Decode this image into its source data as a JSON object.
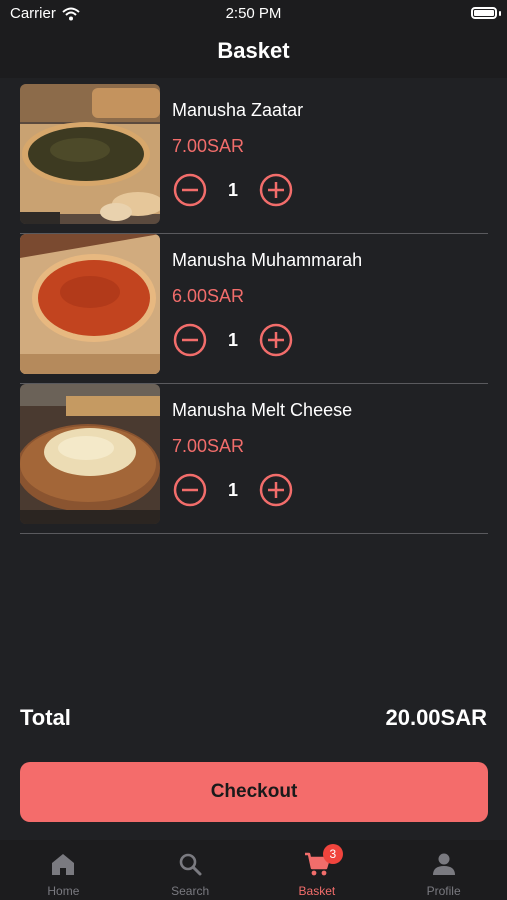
{
  "status_bar": {
    "carrier": "Carrier",
    "time": "2:50 PM"
  },
  "header": {
    "title": "Basket"
  },
  "items": [
    {
      "name": "Manusha Zaatar",
      "price": "7.00SAR",
      "quantity": "1"
    },
    {
      "name": "Manusha Muhammarah",
      "price": "6.00SAR",
      "quantity": "1"
    },
    {
      "name": "Manusha Melt Cheese",
      "price": "7.00SAR",
      "quantity": "1"
    }
  ],
  "summary": {
    "total_label": "Total",
    "total_value": "20.00SAR"
  },
  "checkout": {
    "label": "Checkout"
  },
  "tabbar": {
    "tabs": [
      {
        "label": "Home",
        "icon": "home-icon"
      },
      {
        "label": "Search",
        "icon": "search-icon"
      },
      {
        "label": "Basket",
        "icon": "cart-icon",
        "badge": "3",
        "active": true
      },
      {
        "label": "Profile",
        "icon": "person-icon"
      }
    ]
  },
  "colors": {
    "accent": "#f46c6b",
    "background": "#202124",
    "bar": "#1c1c1e",
    "badge": "#f0443d"
  }
}
